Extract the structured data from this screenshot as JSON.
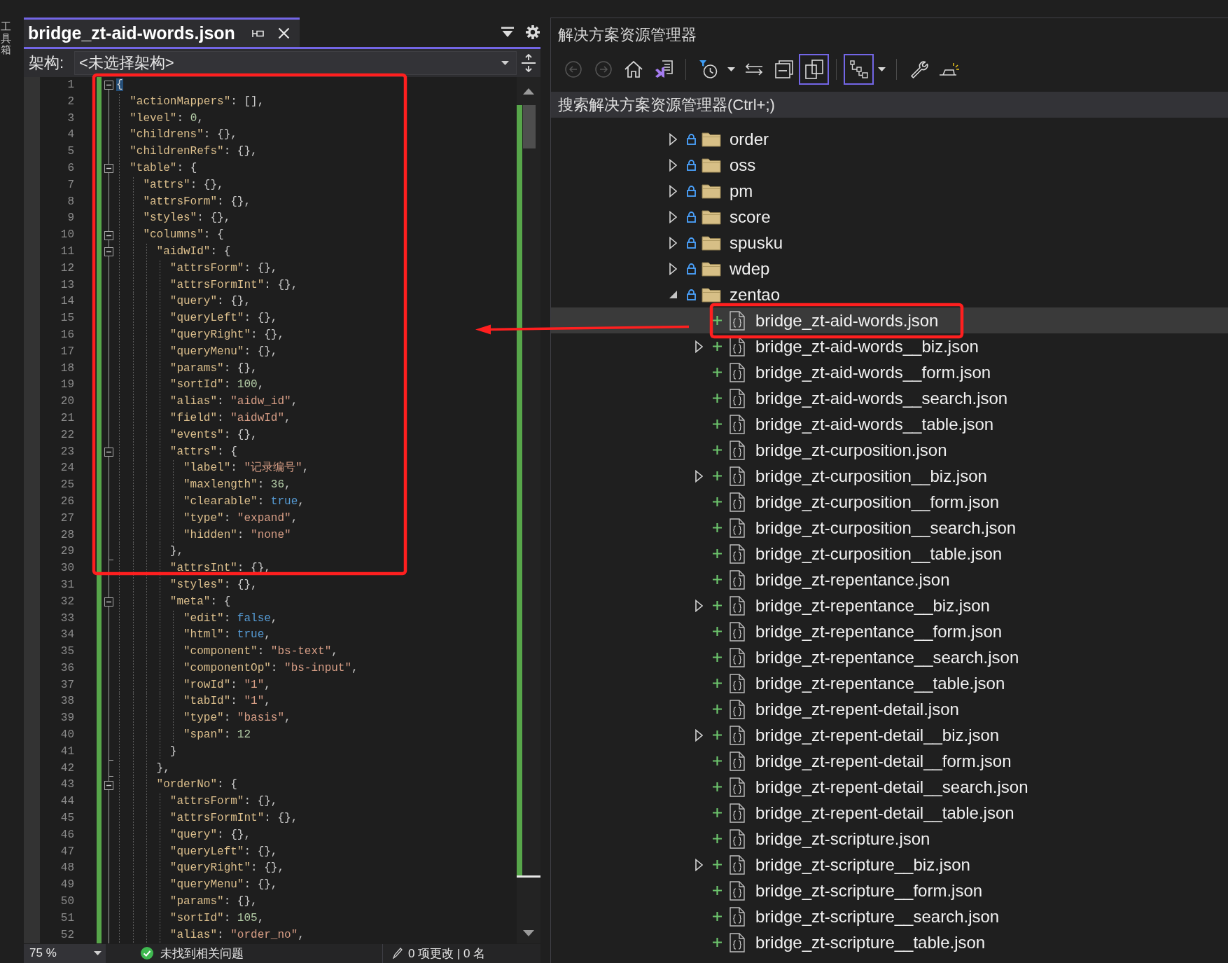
{
  "toolbox": {
    "label": "工具箱"
  },
  "editor": {
    "tab": {
      "title": "bridge_zt-aid-words.json",
      "selected": true
    },
    "navigation": {
      "label": "架构:",
      "value": "<未选择架构>"
    },
    "lines": [
      {
        "number": "1",
        "expanded": true,
        "tokens": [
          {
            "kind": "matched-brace",
            "text": "{"
          }
        ],
        "children": [
          {
            "number": "2",
            "tokens": [
              {
                "kind": "key",
                "text": "\"actionMappers\""
              },
              {
                "kind": "punct",
                "text": ": [],"
              }
            ]
          },
          {
            "number": "3",
            "tokens": [
              {
                "kind": "key",
                "text": "\"level\""
              },
              {
                "kind": "punct",
                "text": ": "
              },
              {
                "kind": "number",
                "text": "0"
              },
              {
                "kind": "punct",
                "text": ","
              }
            ]
          },
          {
            "number": "4",
            "tokens": [
              {
                "kind": "key",
                "text": "\"childrens\""
              },
              {
                "kind": "punct",
                "text": ": {},"
              }
            ]
          },
          {
            "number": "5",
            "tokens": [
              {
                "kind": "key",
                "text": "\"childrenRefs\""
              },
              {
                "kind": "punct",
                "text": ": {},"
              }
            ]
          },
          {
            "number": "6",
            "expanded": true,
            "tokens": [
              {
                "kind": "key",
                "text": "\"table\""
              },
              {
                "kind": "punct",
                "text": ": {"
              }
            ],
            "children": [
              {
                "number": "7",
                "tokens": [
                  {
                    "kind": "key",
                    "text": "\"attrs\""
                  },
                  {
                    "kind": "punct",
                    "text": ": {},"
                  }
                ]
              },
              {
                "number": "8",
                "tokens": [
                  {
                    "kind": "key",
                    "text": "\"attrsForm\""
                  },
                  {
                    "kind": "punct",
                    "text": ": {},"
                  }
                ]
              },
              {
                "number": "9",
                "tokens": [
                  {
                    "kind": "key",
                    "text": "\"styles\""
                  },
                  {
                    "kind": "punct",
                    "text": ": {},"
                  }
                ]
              },
              {
                "number": "10",
                "expanded": true,
                "tokens": [
                  {
                    "kind": "key",
                    "text": "\"columns\""
                  },
                  {
                    "kind": "punct",
                    "text": ": {"
                  }
                ],
                "children": [
                  {
                    "number": "11",
                    "expanded": true,
                    "tokens": [
                      {
                        "kind": "key",
                        "text": "\"aidwId\""
                      },
                      {
                        "kind": "punct",
                        "text": ": {"
                      }
                    ],
                    "children": [
                      {
                        "number": "12",
                        "tokens": [
                          {
                            "kind": "key",
                            "text": "\"attrsForm\""
                          },
                          {
                            "kind": "punct",
                            "text": ": {},"
                          }
                        ]
                      },
                      {
                        "number": "13",
                        "tokens": [
                          {
                            "kind": "key",
                            "text": "\"attrsFormInt\""
                          },
                          {
                            "kind": "punct",
                            "text": ": {},"
                          }
                        ]
                      },
                      {
                        "number": "14",
                        "tokens": [
                          {
                            "kind": "key",
                            "text": "\"query\""
                          },
                          {
                            "kind": "punct",
                            "text": ": {},"
                          }
                        ]
                      },
                      {
                        "number": "15",
                        "tokens": [
                          {
                            "kind": "key",
                            "text": "\"queryLeft\""
                          },
                          {
                            "kind": "punct",
                            "text": ": {},"
                          }
                        ]
                      },
                      {
                        "number": "16",
                        "tokens": [
                          {
                            "kind": "key",
                            "text": "\"queryRight\""
                          },
                          {
                            "kind": "punct",
                            "text": ": {},"
                          }
                        ]
                      },
                      {
                        "number": "17",
                        "tokens": [
                          {
                            "kind": "key",
                            "text": "\"queryMenu\""
                          },
                          {
                            "kind": "punct",
                            "text": ": {},"
                          }
                        ]
                      },
                      {
                        "number": "18",
                        "tokens": [
                          {
                            "kind": "key",
                            "text": "\"params\""
                          },
                          {
                            "kind": "punct",
                            "text": ": {},"
                          }
                        ]
                      },
                      {
                        "number": "19",
                        "tokens": [
                          {
                            "kind": "key",
                            "text": "\"sortId\""
                          },
                          {
                            "kind": "punct",
                            "text": ": "
                          },
                          {
                            "kind": "number",
                            "text": "100"
                          },
                          {
                            "kind": "punct",
                            "text": ","
                          }
                        ]
                      },
                      {
                        "number": "20",
                        "tokens": [
                          {
                            "kind": "key",
                            "text": "\"alias\""
                          },
                          {
                            "kind": "punct",
                            "text": ": "
                          },
                          {
                            "kind": "string",
                            "text": "\"aidw_id\""
                          },
                          {
                            "kind": "punct",
                            "text": ","
                          }
                        ]
                      },
                      {
                        "number": "21",
                        "tokens": [
                          {
                            "kind": "key",
                            "text": "\"field\""
                          },
                          {
                            "kind": "punct",
                            "text": ": "
                          },
                          {
                            "kind": "string",
                            "text": "\"aidwId\""
                          },
                          {
                            "kind": "punct",
                            "text": ","
                          }
                        ]
                      },
                      {
                        "number": "22",
                        "tokens": [
                          {
                            "kind": "key",
                            "text": "\"events\""
                          },
                          {
                            "kind": "punct",
                            "text": ": {},"
                          }
                        ]
                      },
                      {
                        "number": "23",
                        "expanded": true,
                        "tokens": [
                          {
                            "kind": "key",
                            "text": "\"attrs\""
                          },
                          {
                            "kind": "punct",
                            "text": ": {"
                          }
                        ],
                        "children": [
                          {
                            "number": "24",
                            "tokens": [
                              {
                                "kind": "key",
                                "text": "\"label\""
                              },
                              {
                                "kind": "punct",
                                "text": ": "
                              },
                              {
                                "kind": "string",
                                "text": "\"记录编号\""
                              },
                              {
                                "kind": "punct",
                                "text": ","
                              }
                            ]
                          },
                          {
                            "number": "25",
                            "tokens": [
                              {
                                "kind": "key",
                                "text": "\"maxlength\""
                              },
                              {
                                "kind": "punct",
                                "text": ": "
                              },
                              {
                                "kind": "number",
                                "text": "36"
                              },
                              {
                                "kind": "punct",
                                "text": ","
                              }
                            ]
                          },
                          {
                            "number": "26",
                            "tokens": [
                              {
                                "kind": "key",
                                "text": "\"clearable\""
                              },
                              {
                                "kind": "punct",
                                "text": ": "
                              },
                              {
                                "kind": "keyword",
                                "text": "true"
                              },
                              {
                                "kind": "punct",
                                "text": ","
                              }
                            ]
                          },
                          {
                            "number": "27",
                            "tokens": [
                              {
                                "kind": "key",
                                "text": "\"type\""
                              },
                              {
                                "kind": "punct",
                                "text": ": "
                              },
                              {
                                "kind": "string",
                                "text": "\"expand\""
                              },
                              {
                                "kind": "punct",
                                "text": ","
                              }
                            ]
                          },
                          {
                            "number": "28",
                            "tokens": [
                              {
                                "kind": "key",
                                "text": "\"hidden\""
                              },
                              {
                                "kind": "punct",
                                "text": ": "
                              },
                              {
                                "kind": "string",
                                "text": "\"none\""
                              }
                            ]
                          }
                        ],
                        "closing": {
                          "number": "29",
                          "tokens": [
                            {
                              "kind": "punct",
                              "text": "},"
                            }
                          ]
                        }
                      },
                      {
                        "number": "30",
                        "tokens": [
                          {
                            "kind": "key",
                            "text": "\"attrsInt\""
                          },
                          {
                            "kind": "punct",
                            "text": ": {},"
                          }
                        ]
                      },
                      {
                        "number": "31",
                        "tokens": [
                          {
                            "kind": "key",
                            "text": "\"styles\""
                          },
                          {
                            "kind": "punct",
                            "text": ": {},"
                          }
                        ]
                      },
                      {
                        "number": "32",
                        "expanded": true,
                        "tokens": [
                          {
                            "kind": "key",
                            "text": "\"meta\""
                          },
                          {
                            "kind": "punct",
                            "text": ": {"
                          }
                        ],
                        "children": [
                          {
                            "number": "33",
                            "tokens": [
                              {
                                "kind": "key",
                                "text": "\"edit\""
                              },
                              {
                                "kind": "punct",
                                "text": ": "
                              },
                              {
                                "kind": "keyword",
                                "text": "false"
                              },
                              {
                                "kind": "punct",
                                "text": ","
                              }
                            ]
                          },
                          {
                            "number": "34",
                            "tokens": [
                              {
                                "kind": "key",
                                "text": "\"html\""
                              },
                              {
                                "kind": "punct",
                                "text": ": "
                              },
                              {
                                "kind": "keyword",
                                "text": "true"
                              },
                              {
                                "kind": "punct",
                                "text": ","
                              }
                            ]
                          },
                          {
                            "number": "35",
                            "tokens": [
                              {
                                "kind": "key",
                                "text": "\"component\""
                              },
                              {
                                "kind": "punct",
                                "text": ": "
                              },
                              {
                                "kind": "string",
                                "text": "\"bs-text\""
                              },
                              {
                                "kind": "punct",
                                "text": ","
                              }
                            ]
                          },
                          {
                            "number": "36",
                            "tokens": [
                              {
                                "kind": "key",
                                "text": "\"componentOp\""
                              },
                              {
                                "kind": "punct",
                                "text": ": "
                              },
                              {
                                "kind": "string",
                                "text": "\"bs-input\""
                              },
                              {
                                "kind": "punct",
                                "text": ","
                              }
                            ]
                          },
                          {
                            "number": "37",
                            "tokens": [
                              {
                                "kind": "key",
                                "text": "\"rowId\""
                              },
                              {
                                "kind": "punct",
                                "text": ": "
                              },
                              {
                                "kind": "string",
                                "text": "\"1\""
                              },
                              {
                                "kind": "punct",
                                "text": ","
                              }
                            ]
                          },
                          {
                            "number": "38",
                            "tokens": [
                              {
                                "kind": "key",
                                "text": "\"tabId\""
                              },
                              {
                                "kind": "punct",
                                "text": ": "
                              },
                              {
                                "kind": "string",
                                "text": "\"1\""
                              },
                              {
                                "kind": "punct",
                                "text": ","
                              }
                            ]
                          },
                          {
                            "number": "39",
                            "tokens": [
                              {
                                "kind": "key",
                                "text": "\"type\""
                              },
                              {
                                "kind": "punct",
                                "text": ": "
                              },
                              {
                                "kind": "string",
                                "text": "\"basis\""
                              },
                              {
                                "kind": "punct",
                                "text": ","
                              }
                            ]
                          },
                          {
                            "number": "40",
                            "tokens": [
                              {
                                "kind": "key",
                                "text": "\"span\""
                              },
                              {
                                "kind": "punct",
                                "text": ": "
                              },
                              {
                                "kind": "number",
                                "text": "12"
                              }
                            ]
                          }
                        ],
                        "closing": {
                          "number": "41",
                          "tokens": [
                            {
                              "kind": "punct",
                              "text": "}"
                            }
                          ]
                        }
                      }
                    ],
                    "closing": {
                      "number": "42",
                      "tokens": [
                        {
                          "kind": "punct",
                          "text": "},"
                        }
                      ]
                    }
                  },
                  {
                    "number": "43",
                    "expanded": true,
                    "tokens": [
                      {
                        "kind": "key",
                        "text": "\"orderNo\""
                      },
                      {
                        "kind": "punct",
                        "text": ": {"
                      }
                    ],
                    "children": [
                      {
                        "number": "44",
                        "tokens": [
                          {
                            "kind": "key",
                            "text": "\"attrsForm\""
                          },
                          {
                            "kind": "punct",
                            "text": ": {},"
                          }
                        ]
                      },
                      {
                        "number": "45",
                        "tokens": [
                          {
                            "kind": "key",
                            "text": "\"attrsFormInt\""
                          },
                          {
                            "kind": "punct",
                            "text": ": {},"
                          }
                        ]
                      },
                      {
                        "number": "46",
                        "tokens": [
                          {
                            "kind": "key",
                            "text": "\"query\""
                          },
                          {
                            "kind": "punct",
                            "text": ": {},"
                          }
                        ]
                      },
                      {
                        "number": "47",
                        "tokens": [
                          {
                            "kind": "key",
                            "text": "\"queryLeft\""
                          },
                          {
                            "kind": "punct",
                            "text": ": {},"
                          }
                        ]
                      },
                      {
                        "number": "48",
                        "tokens": [
                          {
                            "kind": "key",
                            "text": "\"queryRight\""
                          },
                          {
                            "kind": "punct",
                            "text": ": {},"
                          }
                        ]
                      },
                      {
                        "number": "49",
                        "tokens": [
                          {
                            "kind": "key",
                            "text": "\"queryMenu\""
                          },
                          {
                            "kind": "punct",
                            "text": ": {},"
                          }
                        ]
                      },
                      {
                        "number": "50",
                        "tokens": [
                          {
                            "kind": "key",
                            "text": "\"params\""
                          },
                          {
                            "kind": "punct",
                            "text": ": {},"
                          }
                        ]
                      },
                      {
                        "number": "51",
                        "tokens": [
                          {
                            "kind": "key",
                            "text": "\"sortId\""
                          },
                          {
                            "kind": "punct",
                            "text": ": "
                          },
                          {
                            "kind": "number",
                            "text": "105"
                          },
                          {
                            "kind": "punct",
                            "text": ","
                          }
                        ]
                      },
                      {
                        "number": "52",
                        "tokens": [
                          {
                            "kind": "key",
                            "text": "\"alias\""
                          },
                          {
                            "kind": "punct",
                            "text": ": "
                          },
                          {
                            "kind": "string",
                            "text": "\"order_no\""
                          },
                          {
                            "kind": "punct",
                            "text": ","
                          }
                        ]
                      }
                    ]
                  }
                ]
              }
            ]
          }
        ]
      }
    ],
    "status_bar": {
      "zoom": "75 %",
      "issues": "未找到相关问题",
      "changes": "0 项更改 | 0 名"
    }
  },
  "solution_explorer": {
    "title": "解决方案资源管理器",
    "toolbar": [
      {
        "kind": "back",
        "disabled": true,
        "on": false
      },
      {
        "kind": "forward",
        "disabled": true,
        "on": false
      },
      {
        "kind": "home",
        "disabled": false,
        "on": false
      },
      {
        "kind": "switch-views",
        "disabled": false,
        "on": false
      },
      {
        "kind": "separator"
      },
      {
        "kind": "pending-changes-filter",
        "disabled": false,
        "on": false
      },
      {
        "kind": "dropdown",
        "disabled": false
      },
      {
        "kind": "sync",
        "disabled": false,
        "on": false
      },
      {
        "kind": "collapse-all",
        "disabled": false,
        "on": false
      },
      {
        "kind": "show-all-files",
        "disabled": false,
        "on": true
      },
      {
        "kind": "separator"
      },
      {
        "kind": "hierarchy",
        "disabled": false,
        "on": true
      },
      {
        "kind": "dropdown",
        "disabled": false
      },
      {
        "kind": "separator"
      },
      {
        "kind": "properties",
        "disabled": false,
        "on": false
      },
      {
        "kind": "preview",
        "disabled": false,
        "on": false
      }
    ],
    "search": {
      "placeholder": "搜索解决方案资源管理器(Ctrl+;)"
    },
    "tree": [
      {
        "kind": "folder",
        "label": "order",
        "expanded": false,
        "selected": false
      },
      {
        "kind": "folder",
        "label": "oss",
        "expanded": false,
        "selected": false
      },
      {
        "kind": "folder",
        "label": "pm",
        "expanded": false,
        "selected": false
      },
      {
        "kind": "folder",
        "label": "score",
        "expanded": false,
        "selected": false
      },
      {
        "kind": "folder",
        "label": "spusku",
        "expanded": false,
        "selected": false
      },
      {
        "kind": "folder",
        "label": "wdep",
        "expanded": false,
        "selected": false
      },
      {
        "kind": "folder",
        "label": "zentao",
        "expanded": true,
        "selected": false,
        "children": [
          {
            "kind": "file",
            "label": "bridge_zt-aid-words.json",
            "selected": true
          },
          {
            "kind": "file",
            "label": "bridge_zt-aid-words__biz.json",
            "expanded": false,
            "selected": false
          },
          {
            "kind": "file",
            "label": "bridge_zt-aid-words__form.json",
            "selected": false
          },
          {
            "kind": "file",
            "label": "bridge_zt-aid-words__search.json",
            "selected": false
          },
          {
            "kind": "file",
            "label": "bridge_zt-aid-words__table.json",
            "selected": false
          },
          {
            "kind": "file",
            "label": "bridge_zt-curposition.json",
            "selected": false
          },
          {
            "kind": "file",
            "label": "bridge_zt-curposition__biz.json",
            "expanded": false,
            "selected": false
          },
          {
            "kind": "file",
            "label": "bridge_zt-curposition__form.json",
            "selected": false
          },
          {
            "kind": "file",
            "label": "bridge_zt-curposition__search.json",
            "selected": false
          },
          {
            "kind": "file",
            "label": "bridge_zt-curposition__table.json",
            "selected": false
          },
          {
            "kind": "file",
            "label": "bridge_zt-repentance.json",
            "selected": false
          },
          {
            "kind": "file",
            "label": "bridge_zt-repentance__biz.json",
            "expanded": false,
            "selected": false
          },
          {
            "kind": "file",
            "label": "bridge_zt-repentance__form.json",
            "selected": false
          },
          {
            "kind": "file",
            "label": "bridge_zt-repentance__search.json",
            "selected": false
          },
          {
            "kind": "file",
            "label": "bridge_zt-repentance__table.json",
            "selected": false
          },
          {
            "kind": "file",
            "label": "bridge_zt-repent-detail.json",
            "selected": false
          },
          {
            "kind": "file",
            "label": "bridge_zt-repent-detail__biz.json",
            "expanded": false,
            "selected": false
          },
          {
            "kind": "file",
            "label": "bridge_zt-repent-detail__form.json",
            "selected": false
          },
          {
            "kind": "file",
            "label": "bridge_zt-repent-detail__search.json",
            "selected": false
          },
          {
            "kind": "file",
            "label": "bridge_zt-repent-detail__table.json",
            "selected": false
          },
          {
            "kind": "file",
            "label": "bridge_zt-scripture.json",
            "selected": false
          },
          {
            "kind": "file",
            "label": "bridge_zt-scripture__biz.json",
            "expanded": false,
            "selected": false
          },
          {
            "kind": "file",
            "label": "bridge_zt-scripture__form.json",
            "selected": false
          },
          {
            "kind": "file",
            "label": "bridge_zt-scripture__search.json",
            "selected": false
          },
          {
            "kind": "file",
            "label": "bridge_zt-scripture__table.json",
            "selected": false
          }
        ]
      }
    ]
  },
  "annotations": [
    {
      "kind": "rectangle"
    },
    {
      "kind": "rectangle"
    },
    {
      "kind": "arrow"
    }
  ]
}
